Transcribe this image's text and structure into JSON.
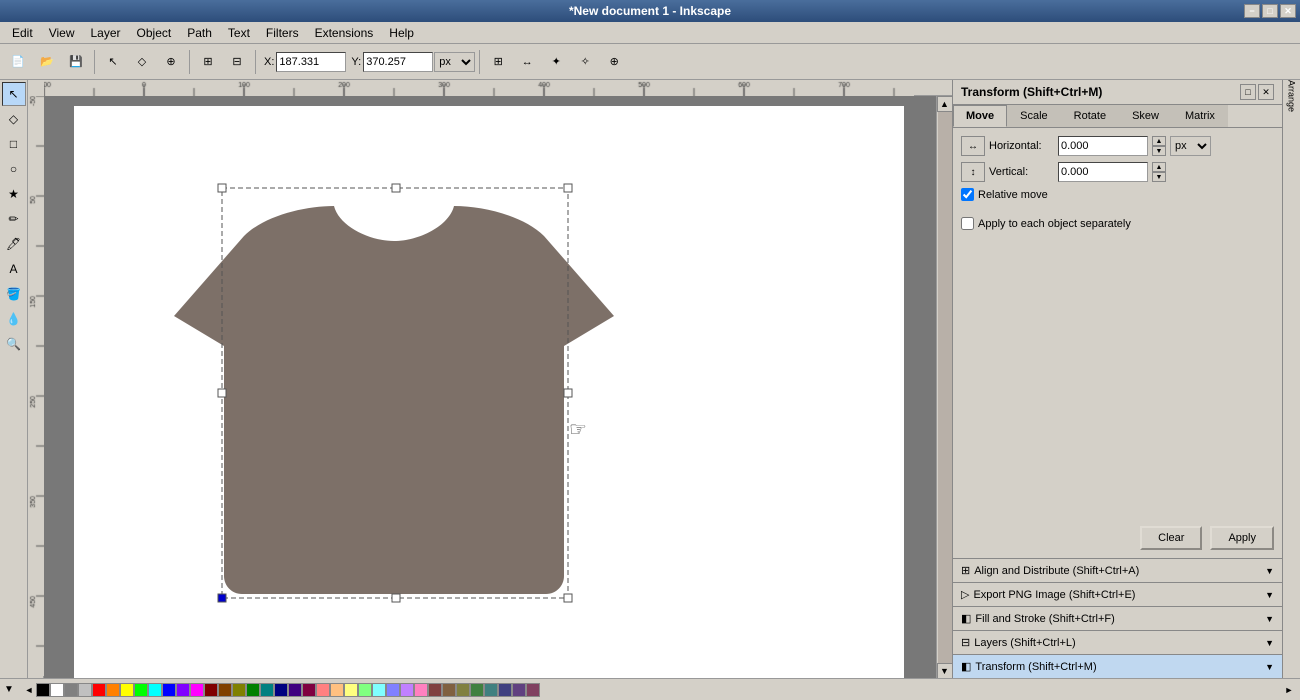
{
  "titlebar": {
    "title": "*New document 1 - Inkscape",
    "minimize": "−",
    "maximize": "□",
    "close": "✕"
  },
  "menubar": {
    "items": [
      "Edit",
      "View",
      "Layer",
      "Object",
      "Path",
      "Text",
      "Filters",
      "Extensions",
      "Help"
    ]
  },
  "toolbar": {
    "x_label": "X:",
    "x_value": "187.331",
    "y_label": "Y:",
    "y_value": "370.257",
    "unit": "px"
  },
  "transform_panel": {
    "title": "Transform (Shift+Ctrl+M)",
    "tabs": [
      "Move",
      "Scale",
      "Rotate",
      "Skew",
      "Matrix"
    ],
    "active_tab": "Move",
    "horizontal_label": "Horizontal:",
    "horizontal_value": "0.000",
    "vertical_label": "Vertical:",
    "vertical_value": "0.000",
    "relative_move_label": "Relative move",
    "relative_move_checked": true,
    "apply_each_label": "Apply to each object separately",
    "apply_each_checked": false,
    "clear_label": "Clear",
    "apply_label": "Apply"
  },
  "collapsible_panels": [
    {
      "id": "align",
      "icon": "⊞",
      "label": "Align and Distribute (Shift+Ctrl+A)",
      "active": false
    },
    {
      "id": "export",
      "icon": "▷",
      "label": "Export PNG Image (Shift+Ctrl+E)",
      "active": false
    },
    {
      "id": "fill",
      "icon": "◧",
      "label": "Fill and Stroke (Shift+Ctrl+F)",
      "active": false
    },
    {
      "id": "layers",
      "icon": "⊟",
      "label": "Layers (Shift+Ctrl+L)",
      "active": false
    },
    {
      "id": "transform",
      "icon": "◧",
      "label": "Transform (Shift+Ctrl+M)",
      "active": true
    }
  ],
  "palette": {
    "colors": [
      "#000000",
      "#ffffff",
      "#808080",
      "#c0c0c0",
      "#ff0000",
      "#ff8000",
      "#ffff00",
      "#00ff00",
      "#00ffff",
      "#0000ff",
      "#8000ff",
      "#ff00ff",
      "#800000",
      "#804000",
      "#808000",
      "#008000",
      "#008080",
      "#000080",
      "#400080",
      "#800040",
      "#ff8080",
      "#ffc080",
      "#ffff80",
      "#80ff80",
      "#80ffff",
      "#8080ff",
      "#c080ff",
      "#ff80c0",
      "#804040",
      "#806040",
      "#808040",
      "#408040",
      "#408080",
      "#404080",
      "#604080",
      "#804060"
    ]
  },
  "tshirt": {
    "color": "#7d7068"
  }
}
